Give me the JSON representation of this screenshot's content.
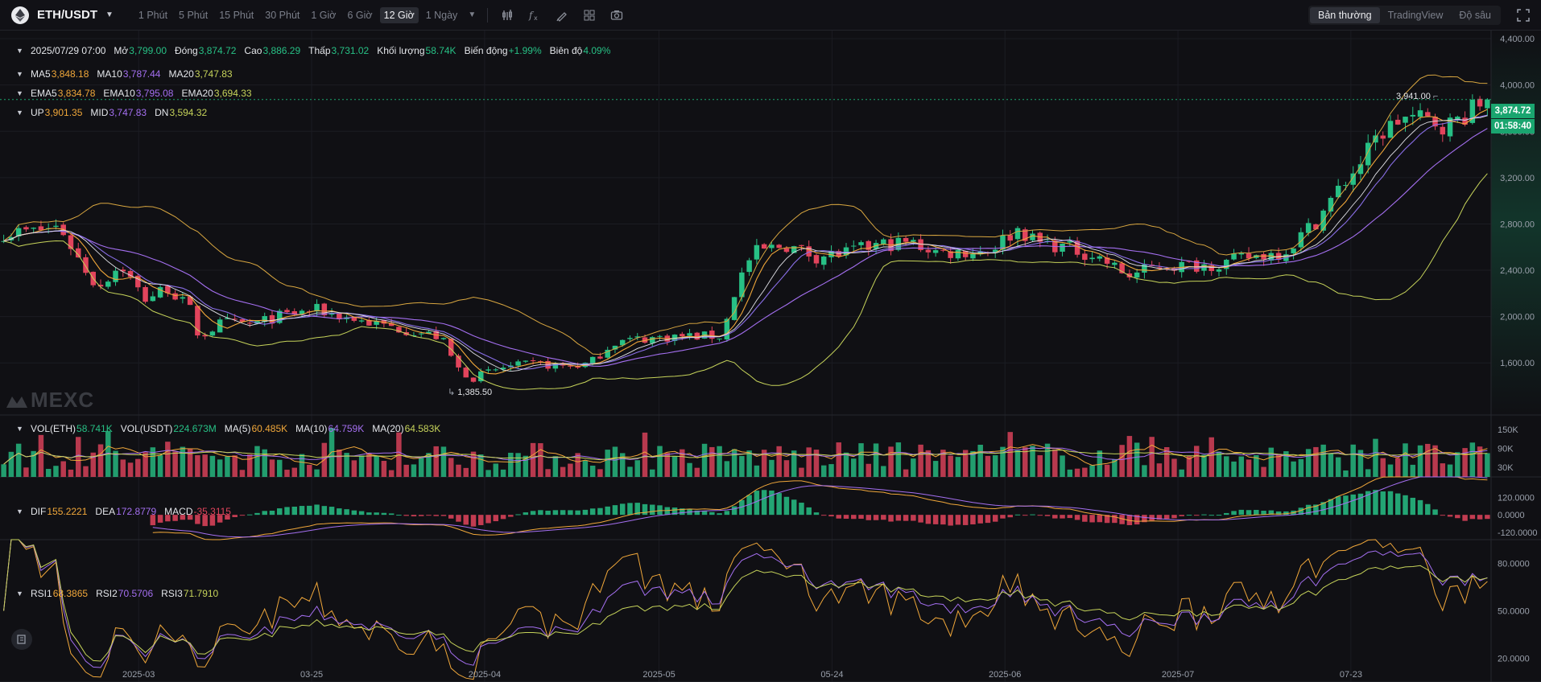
{
  "toolbar": {
    "symbol": "ETH/USDT",
    "intervals": [
      "1 Phút",
      "5 Phút",
      "15 Phút",
      "30 Phút",
      "1 Giờ",
      "6 Giờ",
      "12 Giờ",
      "1 Ngày"
    ],
    "active_interval": "12 Giờ",
    "tool_icons": [
      "candle-type-icon",
      "indicator-icon",
      "draw-icon",
      "settings-icon",
      "layout-icon",
      "screenshot-icon"
    ],
    "views": [
      "Bản thường",
      "TradingView",
      "Độ sâu"
    ],
    "active_view": "Bản thường"
  },
  "ohlc": {
    "date": "2025/07/29 07:00",
    "open_label": "Mở",
    "open": "3,799.00",
    "close_label": "Đóng",
    "close": "3,874.72",
    "high_label": "Cao",
    "high": "3,886.29",
    "low_label": "Thấp",
    "low": "3,731.02",
    "volume_label": "Khối lượng",
    "volume": "58.74K",
    "change_label": "Biến động",
    "change": "+1.99%",
    "amplitude_label": "Biên độ",
    "amplitude": "4.09%"
  },
  "ma": {
    "ma5_label": "MA5",
    "ma5": "3,848.18",
    "ma10_label": "MA10",
    "ma10": "3,787.44",
    "ma20_label": "MA20",
    "ma20": "3,747.83"
  },
  "ema": {
    "ema5_label": "EMA5",
    "ema5": "3,834.78",
    "ema10_label": "EMA10",
    "ema10": "3,795.08",
    "ema20_label": "EMA20",
    "ema20": "3,694.33"
  },
  "boll": {
    "up_label": "UP",
    "up": "3,901.35",
    "mid_label": "MID",
    "mid": "3,747.83",
    "dn_label": "DN",
    "dn": "3,594.32"
  },
  "vol": {
    "eth_label": "VOL(ETH)",
    "eth": "58.741K",
    "usdt_label": "VOL(USDT)",
    "usdt": "224.673M",
    "ma5_label": "MA(5)",
    "ma5": "60.485K",
    "ma10_label": "MA(10)",
    "ma10": "64.759K",
    "ma20_label": "MA(20)",
    "ma20": "64.583K"
  },
  "macd": {
    "dif_label": "DIF",
    "dif": "155.2221",
    "dea_label": "DEA",
    "dea": "172.8779",
    "macd_label": "MACD",
    "macd": "-35.3115"
  },
  "rsi": {
    "rsi1_label": "RSI1",
    "rsi1": "68.3865",
    "rsi2_label": "RSI2",
    "rsi2": "70.5706",
    "rsi3_label": "RSI3",
    "rsi3": "71.7910"
  },
  "watermark": "MEXC",
  "current_price": "3,874.72",
  "countdown": "01:58:40",
  "max_label": "3,941.00",
  "min_label": "1,385.50",
  "colors": {
    "up": "#27c085",
    "down": "#e2445c",
    "ma5": "#f0a73a",
    "ma10": "#a46ff0",
    "ma20": "#c6d35a",
    "bg": "#101014"
  },
  "chart_data": {
    "type": "candlestick",
    "price_axis": [
      "4,400.00",
      "4,000.00",
      "3,600.00",
      "3,200.00",
      "2,800.00",
      "2,400.00",
      "2,000.00",
      "1,600.00"
    ],
    "price_ticks": [
      4400,
      4000,
      3600,
      3200,
      2800,
      2400,
      2000,
      1600
    ],
    "price_range": [
      1150,
      4470
    ],
    "volume_axis": [
      "150K",
      "90K",
      "30K"
    ],
    "volume_ticks": [
      150000,
      90000,
      30000
    ],
    "volume_range": [
      0,
      195000
    ],
    "macd_axis": [
      "120.0000",
      "0.0000",
      "-120.0000"
    ],
    "macd_ticks": [
      120,
      0,
      -120
    ],
    "macd_range": [
      -170,
      260
    ],
    "rsi_axis": [
      "80.0000",
      "50.0000",
      "20.0000"
    ],
    "rsi_ticks": [
      80,
      50,
      20
    ],
    "rsi_range": [
      5,
      95
    ],
    "time_axis": [
      "2025-03",
      "03-25",
      "2025-04",
      "2025-05",
      "05-24",
      "2025-06",
      "2025-07",
      "07-23"
    ],
    "time_ticks": [
      0.093,
      0.209,
      0.325,
      0.442,
      0.558,
      0.674,
      0.79,
      0.906
    ],
    "price_path": [
      [
        0,
        2720
      ],
      [
        0.02,
        2740
      ],
      [
        0.036,
        2780
      ],
      [
        0.045,
        2560
      ],
      [
        0.06,
        2250
      ],
      [
        0.075,
        2450
      ],
      [
        0.09,
        2150
      ],
      [
        0.105,
        2250
      ],
      [
        0.12,
        2050
      ],
      [
        0.125,
        1820
      ],
      [
        0.14,
        1950
      ],
      [
        0.16,
        1930
      ],
      [
        0.175,
        2000
      ],
      [
        0.2,
        2060
      ],
      [
        0.22,
        1990
      ],
      [
        0.24,
        1930
      ],
      [
        0.26,
        1880
      ],
      [
        0.28,
        1820
      ],
      [
        0.29,
        1560
      ],
      [
        0.3,
        1470
      ],
      [
        0.32,
        1560
      ],
      [
        0.34,
        1590
      ],
      [
        0.36,
        1570
      ],
      [
        0.375,
        1590
      ],
      [
        0.39,
        1780
      ],
      [
        0.41,
        1810
      ],
      [
        0.43,
        1830
      ],
      [
        0.46,
        1830
      ],
      [
        0.47,
        2300
      ],
      [
        0.48,
        2550
      ],
      [
        0.5,
        2620
      ],
      [
        0.52,
        2520
      ],
      [
        0.54,
        2550
      ],
      [
        0.56,
        2620
      ],
      [
        0.58,
        2640
      ],
      [
        0.6,
        2550
      ],
      [
        0.63,
        2570
      ],
      [
        0.65,
        2760
      ],
      [
        0.66,
        2650
      ],
      [
        0.68,
        2600
      ],
      [
        0.7,
        2520
      ],
      [
        0.72,
        2350
      ],
      [
        0.74,
        2440
      ],
      [
        0.76,
        2440
      ],
      [
        0.78,
        2460
      ],
      [
        0.8,
        2520
      ],
      [
        0.82,
        2560
      ],
      [
        0.84,
        2820
      ],
      [
        0.855,
        3100
      ],
      [
        0.87,
        3350
      ],
      [
        0.88,
        3560
      ],
      [
        0.895,
        3720
      ],
      [
        0.91,
        3700
      ],
      [
        0.925,
        3650
      ],
      [
        0.94,
        3780
      ],
      [
        0.95,
        3874.72
      ]
    ]
  }
}
